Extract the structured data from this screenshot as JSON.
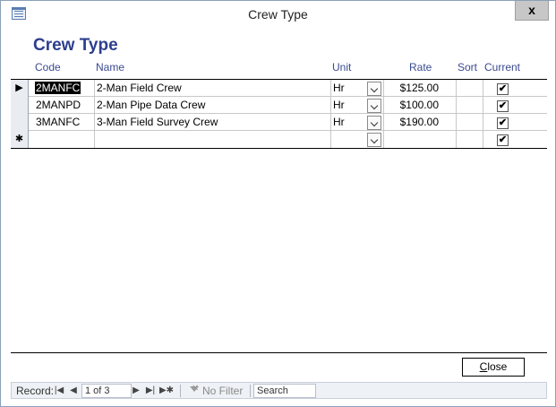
{
  "window": {
    "title": "Crew Type",
    "close_glyph": "x"
  },
  "form": {
    "heading": "Crew Type"
  },
  "columns": {
    "code": "Code",
    "name": "Name",
    "unit": "Unit",
    "rate": "Rate",
    "sort": "Sort",
    "current": "Current"
  },
  "rows": [
    {
      "selector": "▶",
      "code": "2MANFC",
      "name": "2-Man Field Crew",
      "unit": "Hr",
      "rate": "$125.00",
      "sort": "",
      "current": "✔"
    },
    {
      "selector": "",
      "code": "2MANPD",
      "name": "2-Man Pipe Data Crew",
      "unit": "Hr",
      "rate": "$100.00",
      "sort": "",
      "current": "✔"
    },
    {
      "selector": "",
      "code": "3MANFC",
      "name": "3-Man Field Survey Crew",
      "unit": "Hr",
      "rate": "$190.00",
      "sort": "",
      "current": "✔"
    }
  ],
  "new_row": {
    "selector": "✱",
    "current": "✔"
  },
  "buttons": {
    "close_first": "C",
    "close_rest": "lose"
  },
  "navigation": {
    "label": "Record:",
    "first": "|◀",
    "prev": "◀",
    "position": "1 of 3",
    "next": "▶",
    "last": "▶|",
    "new": "▶✱",
    "filter": "No Filter",
    "search": "Search"
  }
}
